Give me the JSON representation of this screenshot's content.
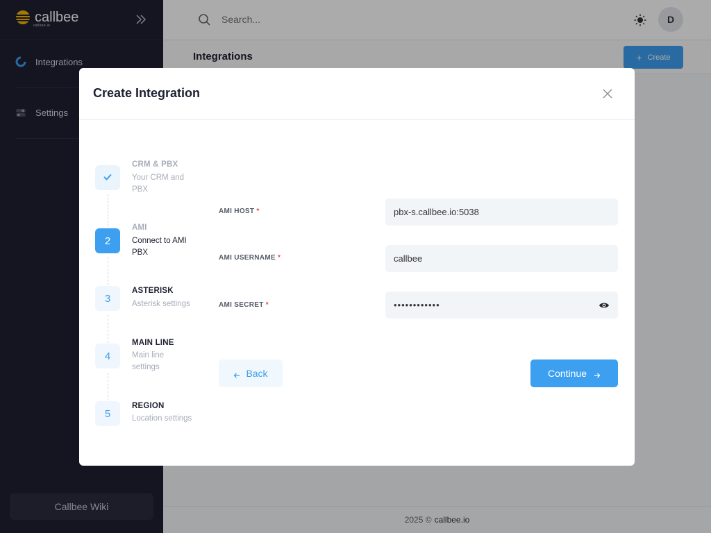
{
  "sidebar": {
    "brand": "callbee",
    "brand_sub": "callbee.io",
    "items": [
      {
        "label": "Integrations",
        "icon": "integrations-icon"
      },
      {
        "label": "Settings",
        "icon": "settings-toggle-icon"
      }
    ],
    "wiki_label": "Callbee Wiki"
  },
  "topbar": {
    "search_placeholder": "Search...",
    "avatar_initial": "D"
  },
  "page": {
    "title": "Integrations",
    "create_label": "Create"
  },
  "footer": {
    "year": "2025 ©",
    "link": "callbee.io"
  },
  "modal": {
    "title": "Create Integration",
    "steps": [
      {
        "number": "",
        "title": "CRM & PBX",
        "desc": "Your CRM and PBX",
        "state": "done"
      },
      {
        "number": "2",
        "title": "AMI",
        "desc": "Connect to AMI PBX",
        "state": "active"
      },
      {
        "number": "3",
        "title": "ASTERISK",
        "desc": "Asterisk settings",
        "state": "todo"
      },
      {
        "number": "4",
        "title": "MAIN LINE",
        "desc": "Main line settings",
        "state": "todo"
      },
      {
        "number": "5",
        "title": "REGION",
        "desc": "Location settings",
        "state": "todo"
      }
    ],
    "fields": {
      "host_label": "AMI HOST",
      "host_value": "pbx-s.callbee.io:5038",
      "username_label": "AMI USERNAME",
      "username_value": "callbee",
      "secret_label": "AMI SECRET",
      "secret_value": "••••••••••••",
      "required_mark": "*"
    },
    "back_label": "Back",
    "continue_label": "Continue"
  },
  "colors": {
    "accent": "#3d9ff0",
    "sidebar_bg": "#1e2031",
    "brand_yellow": "#f5b800"
  }
}
